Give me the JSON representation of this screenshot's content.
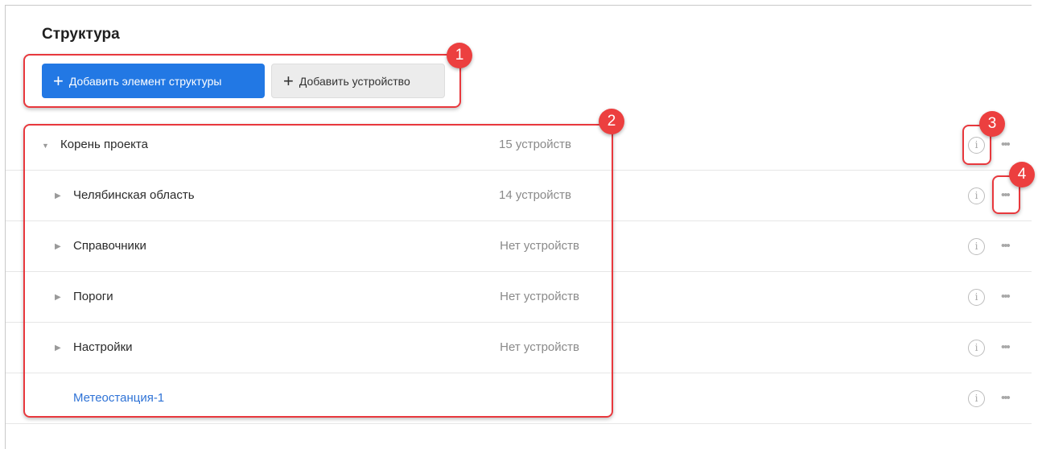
{
  "page": {
    "title": "Структура"
  },
  "toolbar": {
    "add_structure_label": "Добавить элемент структуры",
    "add_device_label": "Добавить устройство",
    "plus": "+"
  },
  "tree": {
    "rows": [
      {
        "name": "Корень проекта",
        "count": "15 устройств",
        "expanded": true,
        "level": 0
      },
      {
        "name": "Челябинская область",
        "count": "14 устройств",
        "expanded": false,
        "level": 1
      },
      {
        "name": "Справочники",
        "count": "Нет устройств",
        "expanded": false,
        "level": 1
      },
      {
        "name": "Пороги",
        "count": "Нет устройств",
        "expanded": false,
        "level": 1
      },
      {
        "name": "Настройки",
        "count": "Нет устройств",
        "expanded": false,
        "level": 1
      },
      {
        "name": "Метеостанция-1",
        "count": "",
        "expanded": null,
        "level": 1
      }
    ],
    "info_glyph": "i",
    "more_glyph": "•••",
    "collapsed_arrow": "▶",
    "expanded_arrow": "▼"
  },
  "annotations": {
    "badges": [
      "1",
      "2",
      "3",
      "4"
    ]
  },
  "colors": {
    "primary": "#2278e4",
    "link": "#2f73d6",
    "callout": "#e8383d"
  }
}
